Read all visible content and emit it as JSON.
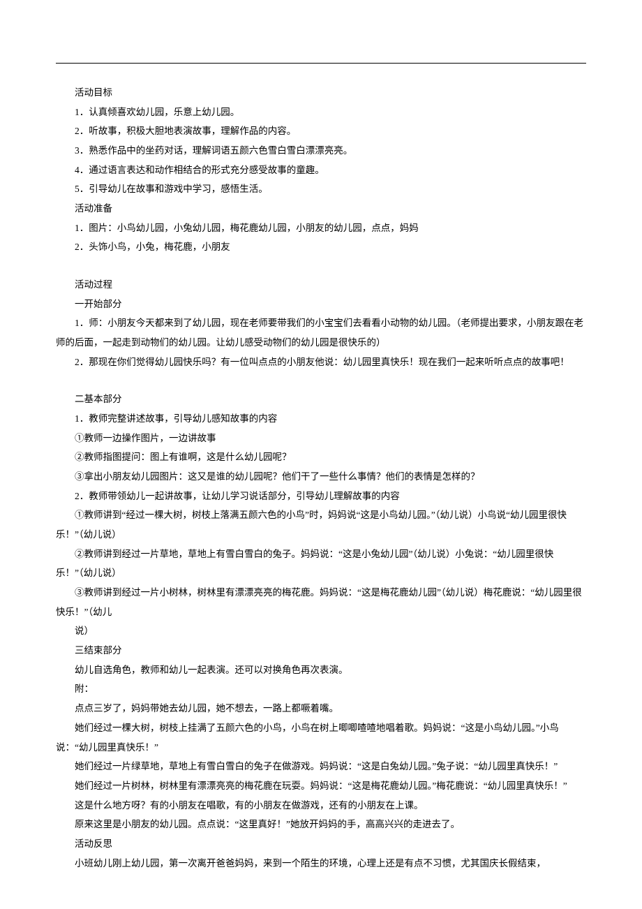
{
  "document": {
    "sections": [
      {
        "id": "goals",
        "heading": "活动目标",
        "lines": [
          "1．认真倾喜欢幼儿园，乐意上幼儿园。",
          "2．听故事，积极大胆地表演故事，理解作品的内容。",
          "3．熟悉作品中的坐药对话，理解词语五颜六色雪白雪白漂漂亮亮。",
          "4．通过语言表达和动作相结合的形式充分感受故事的童趣。",
          "5．引导幼儿在故事和游戏中学习，感悟生活。"
        ]
      },
      {
        "id": "prep",
        "heading": "活动准备",
        "lines": [
          "1．图片：小鸟幼儿园，小兔幼儿园，梅花鹿幼儿园，小朋友的幼儿园，点点，妈妈",
          "2．头饰小鸟，小兔，梅花鹿，小朋友"
        ]
      },
      {
        "id": "process",
        "heading": "活动过程",
        "subheadings": [
          {
            "id": "part1",
            "title": "一开始部分",
            "paragraphs": [
              "1．师：小朋友今天都来到了幼儿园，现在老师要带我们的小宝宝们去看看小动物的幼儿园。（老师提出要求，小朋友跟在老师的后面，一起走到动物们的幼儿园。让幼儿感受动物们的幼儿园是很快乐的）",
              "2．那现在你们觉得幼儿园快乐吗？有一位叫点点的小朋友他说：幼儿园里真快乐！现在我们一起来听听点点的故事吧！"
            ]
          },
          {
            "id": "part2",
            "title": "二基本部分",
            "paragraphs": [
              "1．教师完整讲述故事，引导幼儿感知故事的内容",
              "①教师一边操作图片，一边讲故事",
              "②教师指图提问：图上有谁啊，这是什么幼儿园呢？",
              "③拿出小朋友幼儿园图片：这又是谁的幼儿园呢？他们干了一些什么事情？他们的表情是怎样的？",
              "2．教师带领幼儿一起讲故事，让幼儿学习说话部分，引导幼儿理解故事的内容",
              "①教师讲到“经过一棵大树，树枝上落满五颜六色的小鸟”时，妈妈说“这是小鸟幼儿园。”（幼儿说）小鸟说“幼儿园里很快乐！”（幼儿说）",
              "②教师讲到经过一片草地，草地上有雪白雪白的兔子。妈妈说：“这是小兔幼儿园”（幼儿说）小兔说：“幼儿园里很快乐！”（幼儿说）",
              "③教师讲到经过一片小树林，树林里有漂漂亮亮的梅花鹿。妈妈说：“这是梅花鹿幼儿园”（幼儿说）梅花鹿说：“幼儿园里很快乐！”（幼儿",
              "说）"
            ]
          },
          {
            "id": "part3",
            "title": "三结束部分",
            "paragraphs": [
              "幼儿自选角色，教师和幼儿一起表演。还可以对换角色再次表演。"
            ]
          }
        ]
      },
      {
        "id": "appendix",
        "heading": "附：",
        "paragraphs": [
          "点点三岁了，妈妈带她去幼儿园，她不想去，一路上都噘着嘴。",
          "她们经过一棵大树，树枝上挂满了五颜六色的小鸟，小鸟在树上唧唧喳喳地唱着歌。妈妈说：“这是小鸟幼儿园。”小鸟说：“幼儿园里真快乐！”",
          "她们经过一片绿草地，草地上有雪白雪白的兔子在做游戏。妈妈说：“这是白兔幼儿园。”兔子说：“幼儿园里真快乐！”",
          "她们经过一片树林，树林里有漂漂亮亮的梅花鹿在玩耍。妈妈说：“这是梅花鹿幼儿园。”梅花鹿说：“幼儿园里真快乐！”",
          "这是什么地方呀？有的小朋友在唱歌，有的小朋友在做游戏，还有的小朋友在上课。",
          "原来这里是小朋友的幼儿园。点点说：“这里真好！”她放开妈妈的手，高高兴兴的走进去了。"
        ]
      },
      {
        "id": "reflection",
        "heading": "活动反思",
        "paragraphs": [
          "小班幼儿刚上幼儿园，第一次离开爸爸妈妈，来到一个陌生的环境，心理上还是有点不习惯，尤其国庆长假结束，"
        ]
      }
    ]
  }
}
